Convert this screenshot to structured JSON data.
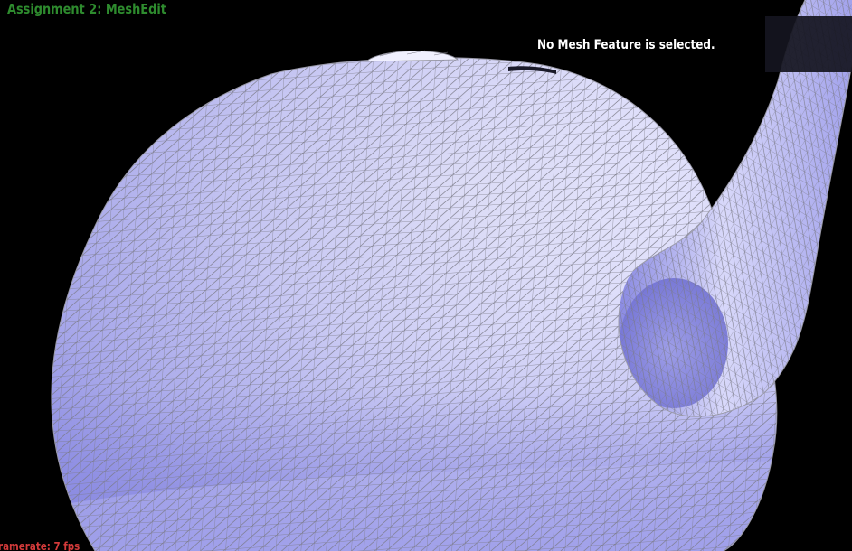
{
  "app": {
    "title": "Assignment 2: MeshEdit"
  },
  "status": {
    "selection_text": "No Mesh Feature is selected."
  },
  "footer": {
    "framerate_text": "ramerate: 7 fps"
  },
  "colors": {
    "background": "#000000",
    "title": "#2e8b2e",
    "status": "#ffffff",
    "framerate": "#d23a3a",
    "mesh_fill_light": "#f4f4ff",
    "mesh_fill_mid": "#c6c6f6",
    "mesh_fill_dark": "#8c8ce4",
    "wireframe": "#7a7a86"
  },
  "mesh": {
    "object": "teapot",
    "render_mode": "wireframe-over-shaded"
  }
}
